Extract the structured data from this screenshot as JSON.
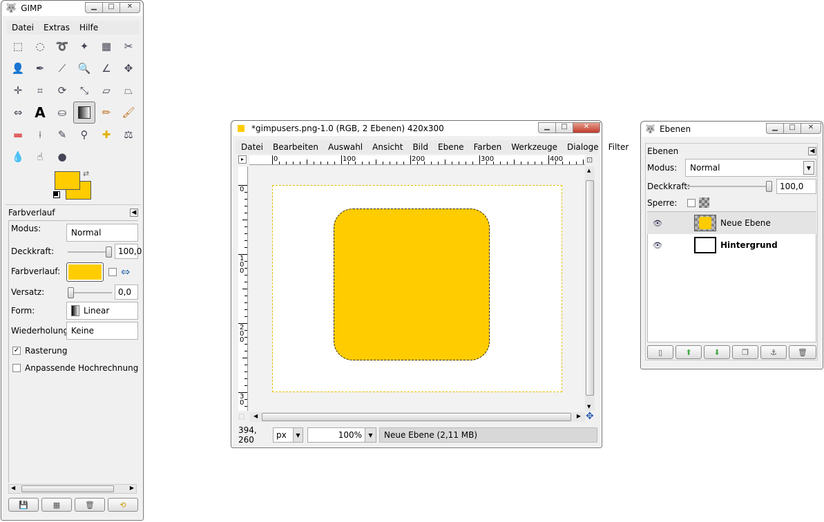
{
  "toolbox": {
    "title": "GIMP",
    "menu": [
      "Datei",
      "Extras",
      "Hilfe"
    ],
    "tools": [
      "rect-select-icon",
      "ellipse-select-icon",
      "lasso-icon",
      "magic-wand-icon",
      "color-select-icon",
      "scissors-icon",
      "foreground-select-icon",
      "paths-icon",
      "color-picker-icon",
      "zoom-icon",
      "measure-icon",
      "move-icon",
      "align-icon",
      "crop-icon",
      "rotate-icon",
      "scale-icon",
      "shear-icon",
      "perspective-icon",
      "flip-icon",
      "text-icon",
      "bucket-fill-icon",
      "blend-icon",
      "pencil-icon",
      "paintbrush-icon",
      "eraser-icon",
      "airbrush-icon",
      "ink-icon",
      "clone-icon",
      "heal-icon",
      "perspective-clone-icon",
      "blur-icon",
      "smudge-icon",
      "dodge-burn-icon"
    ],
    "colors": {
      "foreground": "#ffcc00",
      "background": "#ffcc00"
    },
    "options_title": "Farbverlauf",
    "labels": {
      "mode": "Modus:",
      "opacity": "Deckkraft:",
      "gradient": "Farbverlauf:",
      "offset": "Versatz:",
      "shape": "Form:",
      "repeat": "Wiederholung:",
      "dither": "Rasterung",
      "adaptive": "Anpassende Hochrechnung"
    },
    "values": {
      "mode": "Normal",
      "opacity": "100,0",
      "offset": "0,0",
      "shape": "Linear",
      "repeat": "Keine"
    },
    "opacity_level": 1.0,
    "offset_level": 0.0,
    "dither_checked": true,
    "adaptive_checked": false
  },
  "image_window": {
    "title": "*gimpusers.png-1.0 (RGB, 2 Ebenen) 420x300",
    "menu": [
      "Datei",
      "Bearbeiten",
      "Auswahl",
      "Ansicht",
      "Bild",
      "Ebene",
      "Farben",
      "Werkzeuge",
      "Dialoge",
      "Filter"
    ],
    "ruler_h": [
      "0",
      "100",
      "200",
      "300",
      "400"
    ],
    "ruler_v": [
      "0",
      "1\n0\n0",
      "2\n0\n0",
      "3\n0"
    ],
    "canvas_fill": "#ffcc00",
    "status": {
      "coords": "394, 260",
      "unit": "px",
      "zoom": "100%",
      "info": "Neue Ebene (2,11 MB)"
    }
  },
  "layers": {
    "title": "Ebenen",
    "tab": "Ebenen",
    "mode_label": "Modus:",
    "mode_value": "Normal",
    "opacity_label": "Deckkraft:",
    "opacity_value": "100,0",
    "opacity_level": 1.0,
    "lock_label": "Sperre:",
    "items": [
      {
        "name": "Neue Ebene",
        "bold": false,
        "selected": true
      },
      {
        "name": "Hintergrund",
        "bold": true,
        "selected": false
      }
    ]
  }
}
